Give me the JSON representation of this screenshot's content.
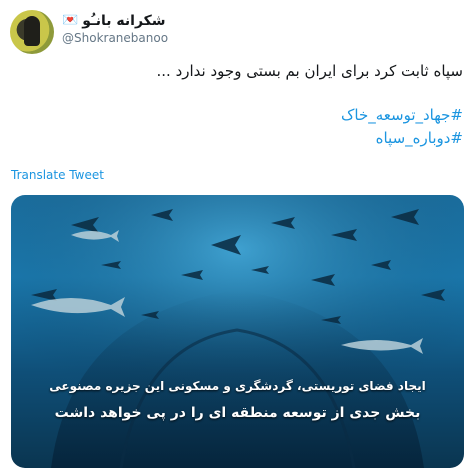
{
  "tweet": {
    "display_name": "شکرانه بانـُو",
    "name_emoji": "💌",
    "handle": "@Shokranebanoo",
    "text": "سپاه ثابت کرد برای ایران بم بستی وجود ندارد ...",
    "hashtags": [
      "#جهاد_توسعه_خاک",
      "#دوباره_سپاه"
    ],
    "translate_label": "Translate Tweet"
  },
  "media": {
    "caption_line_1": "ایجاد فضای توریستی، گردشگری و مسکونی این جزیره مصنوعی",
    "caption_line_2": "بخش جدی از توسعه منطقه ای را در پی خواهد داشت"
  },
  "colors": {
    "link": "#1b95e0",
    "text": "#14171a",
    "muted": "#657786"
  }
}
